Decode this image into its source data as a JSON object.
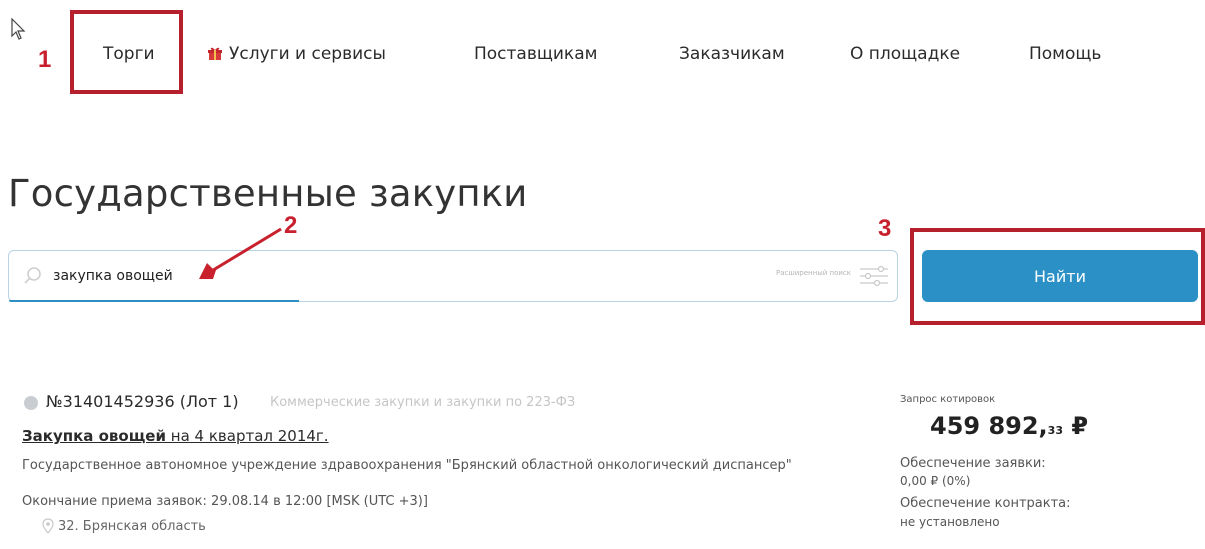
{
  "annotations": {
    "step1": "1",
    "step2": "2",
    "step3": "3"
  },
  "nav": {
    "items": [
      {
        "label": "Торги"
      },
      {
        "label": "Услуги и сервисы",
        "icon": "gift-icon"
      },
      {
        "label": "Поставщикам"
      },
      {
        "label": "Заказчикам"
      },
      {
        "label": "О площадке"
      },
      {
        "label": "Помощь"
      }
    ]
  },
  "page": {
    "title": "Государственные закупки"
  },
  "search": {
    "value": "закупка овощей",
    "advanced_label": "Расширенный поиск",
    "button_label": "Найти"
  },
  "result": {
    "number": "№31401452936 (Лот 1)",
    "type": "Коммерческие закупки и закупки по 223-ФЗ",
    "title_link": "Закупка овощей",
    "title_rest": " на 4 квартал 2014г.",
    "customer": "Государственное автономное учреждение здравоохранения \"Брянский областной онкологический диспансер\"",
    "deadline": "Окончание приема заявок: 29.08.14 в 12:00 [MSK (UTC +3)]",
    "region": "32. Брянская область",
    "procedure_type": "Запрос котировок",
    "price_main": "459 892,",
    "price_kop": "33",
    "currency": " ₽",
    "app_security_label": "Обеспечение заявки:",
    "app_security_value": "0,00 ₽ (0%)",
    "contract_security_label": "Обеспечение контракта:",
    "contract_security_value": "не установлено"
  },
  "colors": {
    "accent": "#2a90c6",
    "annotation": "#c8202c"
  }
}
